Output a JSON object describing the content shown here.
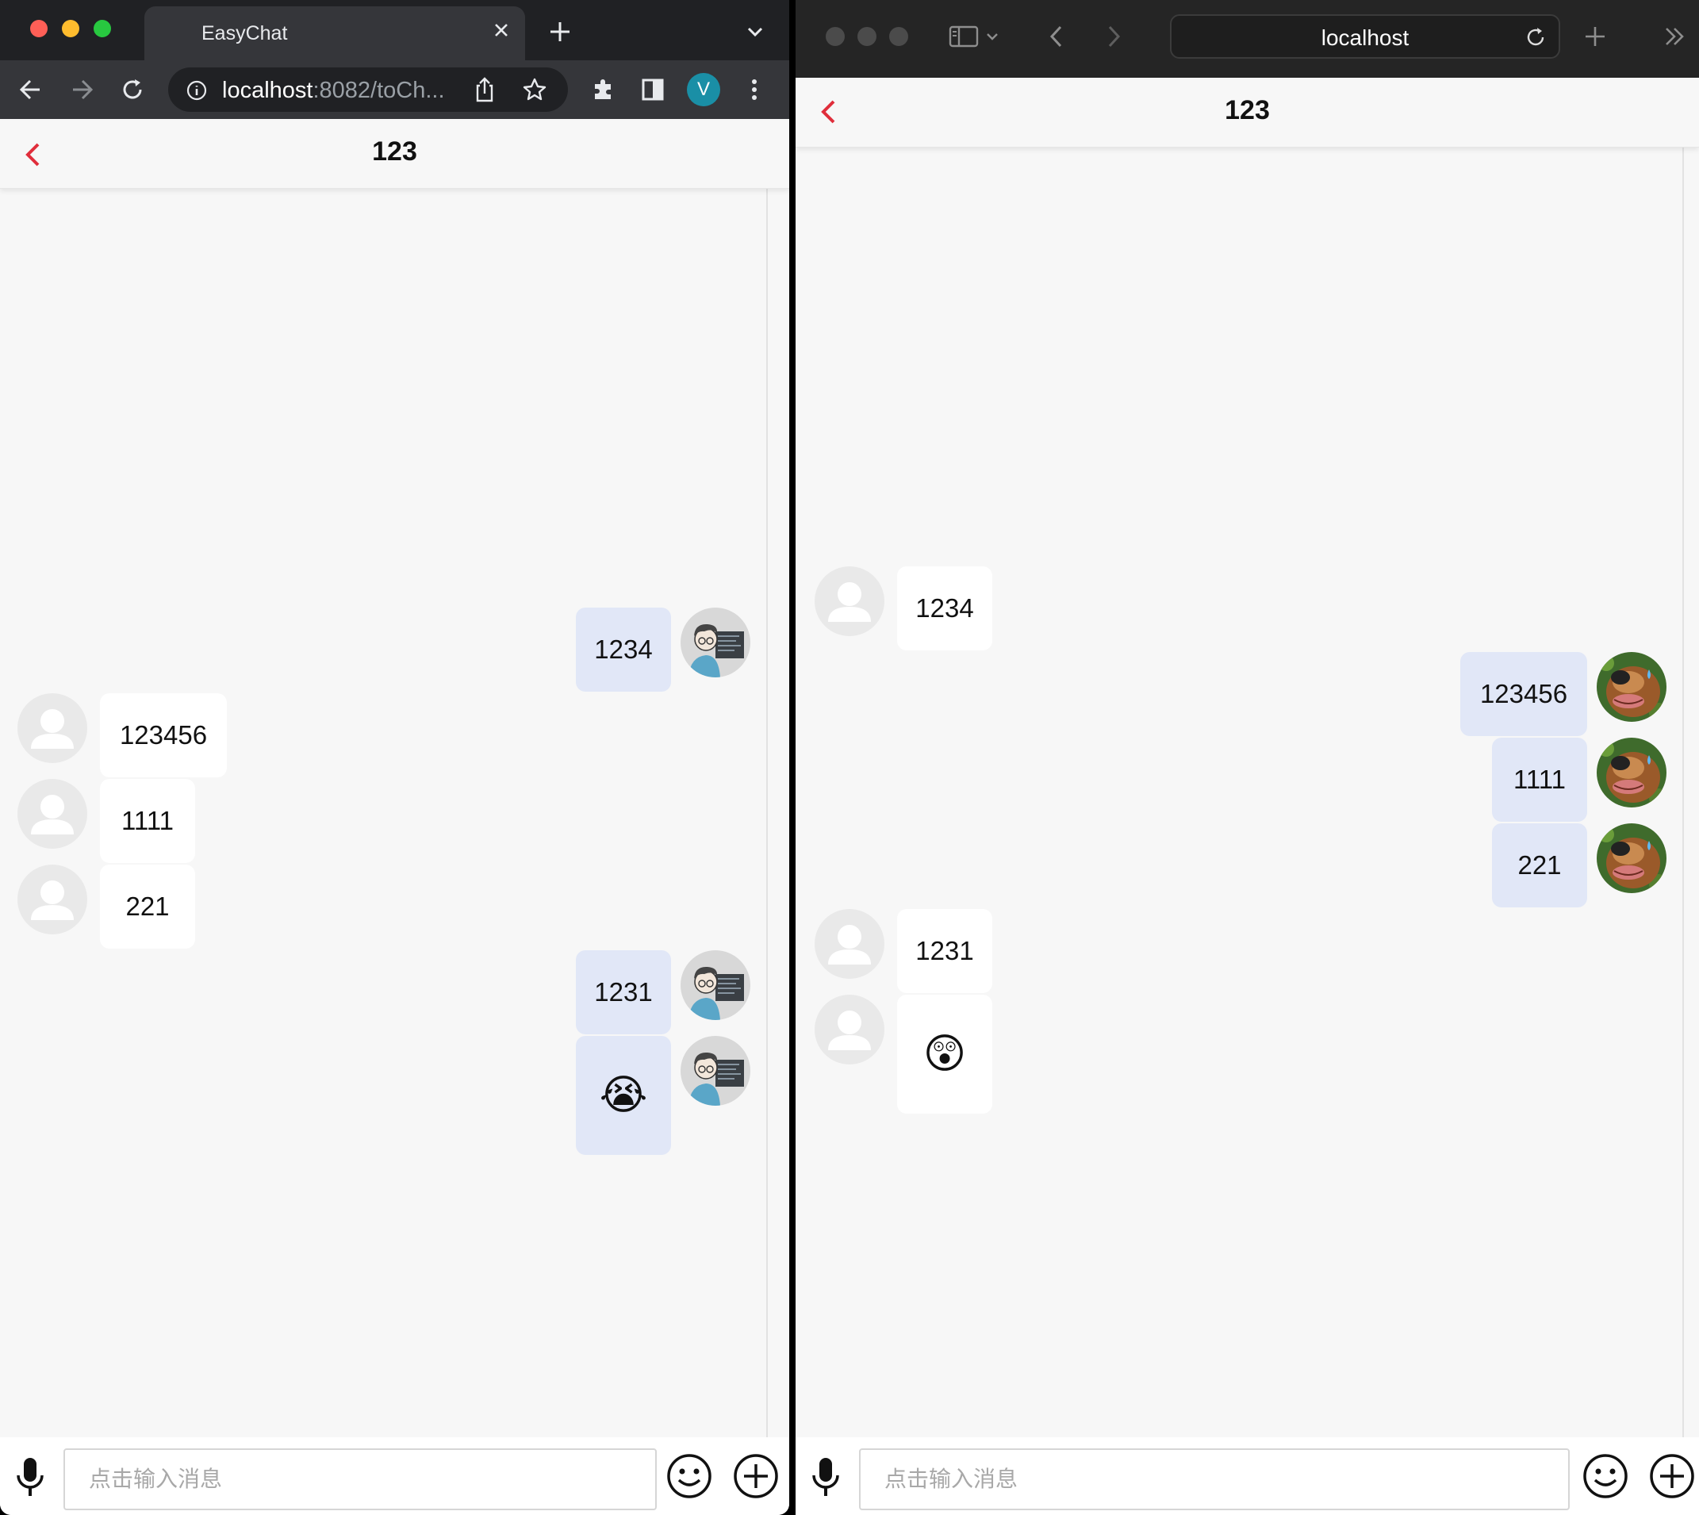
{
  "left_browser": {
    "tab_title": "EasyChat",
    "url_host": "localhost",
    "url_rest": ":8082/toCh...",
    "profile_initial": "V",
    "app": {
      "title": "123",
      "input_placeholder": "点击输入消息",
      "messages": [
        {
          "side": "right",
          "text": "1234",
          "avatar": "developer-avatar"
        },
        {
          "side": "left",
          "text": "123456",
          "avatar": "default-avatar"
        },
        {
          "side": "left",
          "text": "1111",
          "avatar": "default-avatar"
        },
        {
          "side": "left",
          "text": "221",
          "avatar": "default-avatar"
        },
        {
          "side": "right",
          "text": "1231",
          "avatar": "developer-avatar"
        },
        {
          "side": "right",
          "text": "😭",
          "avatar": "developer-avatar",
          "emoji": true
        }
      ]
    }
  },
  "right_browser": {
    "url": "localhost",
    "app": {
      "title": "123",
      "input_placeholder": "点击输入消息",
      "messages": [
        {
          "side": "left",
          "text": "1234",
          "avatar": "default-avatar"
        },
        {
          "side": "right",
          "text": "123456",
          "avatar": "dog-avatar"
        },
        {
          "side": "right",
          "text": "1111",
          "avatar": "dog-avatar"
        },
        {
          "side": "right",
          "text": "221",
          "avatar": "dog-avatar"
        },
        {
          "side": "left",
          "text": "1231",
          "avatar": "default-avatar"
        },
        {
          "side": "left",
          "text": "😲",
          "avatar": "default-avatar",
          "emoji": true
        }
      ]
    }
  },
  "colors": {
    "accent_back": "#e02e3b",
    "self_bubble": "#e1e7f7",
    "other_bubble": "#ffffff",
    "chrome_dark": "#202124",
    "chrome_toolbar": "#35363a",
    "safari_dark": "#252525",
    "profile_avatar": "#1a8fa6"
  }
}
